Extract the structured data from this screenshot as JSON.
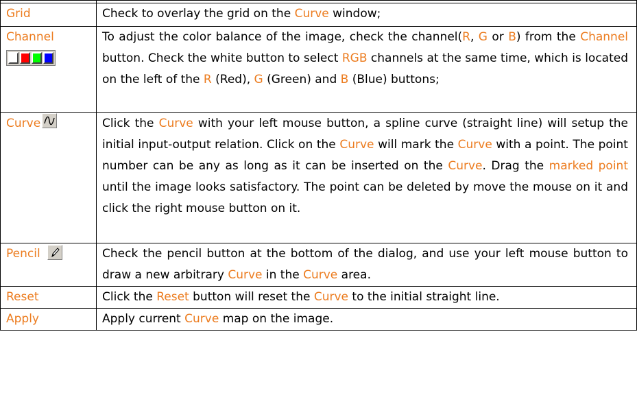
{
  "rows": [
    {
      "name": "Grid",
      "desc": [
        {
          "t": "Check to overlay the grid on the "
        },
        {
          "t": "Curve",
          "hl": true
        },
        {
          "t": " window;"
        }
      ]
    },
    {
      "name": "Channel",
      "icon": "channel-swatches",
      "swatch_colors": [
        "#ffffff",
        "#ff0000",
        "#00ff00",
        "#0000ff"
      ],
      "desc": [
        {
          "t": "To adjust the color balance of the image, check the channel("
        },
        {
          "t": "R",
          "hl": true
        },
        {
          "t": ", "
        },
        {
          "t": "G",
          "hl": true
        },
        {
          "t": " or "
        },
        {
          "t": "B",
          "hl": true
        },
        {
          "t": ") from the "
        },
        {
          "t": "Channel",
          "hl": true
        },
        {
          "t": " button. Check the white button to select "
        },
        {
          "t": "RGB",
          "hl": true
        },
        {
          "t": " channels at the same time, which is located on the left of the "
        },
        {
          "t": "R",
          "hl": true
        },
        {
          "t": " (Red), "
        },
        {
          "t": "G",
          "hl": true
        },
        {
          "t": " (Green) and "
        },
        {
          "t": "B",
          "hl": true
        },
        {
          "t": " (Blue) buttons;"
        }
      ]
    },
    {
      "name": "Curve",
      "icon": "curve-icon",
      "desc": [
        {
          "t": "Click the "
        },
        {
          "t": "Curve",
          "hl": true
        },
        {
          "t": " with your left mouse button, a spline curve (straight line) will setup the initial input-output relation. Click on the "
        },
        {
          "t": "Curve",
          "hl": true
        },
        {
          "t": " will mark the "
        },
        {
          "t": "Curve",
          "hl": true
        },
        {
          "t": " with a point. The point number can be any as long as it can be inserted on the "
        },
        {
          "t": "Curve",
          "hl": true
        },
        {
          "t": ". Drag the "
        },
        {
          "t": "marked point",
          "hl": true
        },
        {
          "t": " until the image looks satisfactory. The point can be deleted by move the mouse on it and click the right mouse button on it."
        }
      ]
    },
    {
      "name": "Pencil",
      "icon": "pencil-icon",
      "desc": [
        {
          "t": "Check the pencil button at the bottom of the dialog, and use your left mouse button to draw a new arbitrary "
        },
        {
          "t": "Curve",
          "hl": true
        },
        {
          "t": " in the "
        },
        {
          "t": "Curve",
          "hl": true
        },
        {
          "t": " area."
        }
      ]
    },
    {
      "name": "Reset",
      "desc": [
        {
          "t": "Click the "
        },
        {
          "t": "Reset",
          "hl": true
        },
        {
          "t": " button will reset the "
        },
        {
          "t": "Curve",
          "hl": true
        },
        {
          "t": " to the initial straight line."
        }
      ]
    },
    {
      "name": "Apply",
      "desc": [
        {
          "t": "Apply current "
        },
        {
          "t": "Curve",
          "hl": true
        },
        {
          "t": " map on the image."
        }
      ]
    }
  ],
  "colors": {
    "highlight": "#ec7c1f",
    "border": "#000000",
    "text": "#000000"
  }
}
